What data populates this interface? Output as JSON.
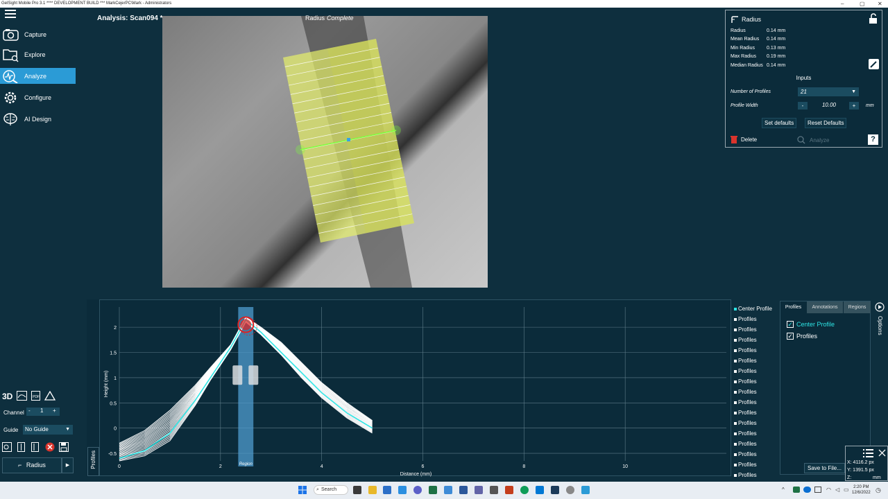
{
  "titlebar": {
    "text": "GelSight Mobile Pro 3.1 **** DEVELOPMENT BUILD ***   MarkCejerPC\\Mark - Administrators"
  },
  "nav": [
    {
      "label": "Capture",
      "icon": "camera-icon"
    },
    {
      "label": "Explore",
      "icon": "folder-search-icon"
    },
    {
      "label": "Analyze",
      "icon": "analyze-icon"
    },
    {
      "label": "Configure",
      "icon": "gear-icon"
    },
    {
      "label": "AI Design",
      "icon": "brain-icon"
    }
  ],
  "analysis": {
    "title": "Analysis: Scan094",
    "title_suffix": "*"
  },
  "image_label": {
    "tool": "Radius",
    "status": "Complete"
  },
  "radius_panel": {
    "title": "Radius",
    "stats": [
      {
        "label": "Radius",
        "value": "0.14 mm"
      },
      {
        "label": "Mean Radius",
        "value": "0.14 mm"
      },
      {
        "label": "Min Radius",
        "value": "0.13 mm"
      },
      {
        "label": "Max Radius",
        "value": "0.19 mm"
      },
      {
        "label": "Median Radius",
        "value": "0.14 mm"
      }
    ],
    "inputs_heading": "Inputs",
    "num_profiles_label": "Number of Profiles",
    "num_profiles_value": "21",
    "profile_width_label": "Profile Width",
    "profile_width_value": "10.00",
    "profile_width_unit": "mm",
    "minus": "-",
    "plus": "+",
    "set_defaults": "Set defaults",
    "reset_defaults": "Reset Defaults",
    "delete": "Delete",
    "analyze": "Analyze",
    "help": "?"
  },
  "chart_data": {
    "type": "line",
    "xlabel": "Distance (mm)",
    "ylabel": "Height (mm)",
    "xlim": [
      0,
      12
    ],
    "ylim": [
      -0.65,
      2.4
    ],
    "x_ticks": [
      "0",
      "2",
      "4",
      "6",
      "8",
      "10"
    ],
    "y_ticks": [
      "2",
      "1.5",
      "1",
      "0.5",
      "0",
      "-0.5"
    ],
    "region_label": "Region",
    "region_x": [
      2.35,
      2.65
    ],
    "series": [
      {
        "name": "Center Profile",
        "x": [
          0,
          0.5,
          1,
          1.5,
          1.8,
          2.2,
          2.5,
          2.8,
          3.2,
          3.6,
          4,
          4.5,
          5
        ],
        "y": [
          -0.6,
          -0.45,
          -0.1,
          0.55,
          1.0,
          1.6,
          2.15,
          1.9,
          1.5,
          1.1,
          0.7,
          0.3,
          0.0
        ]
      },
      {
        "name": "Profiles",
        "x": [
          0,
          0.5,
          1,
          1.5,
          1.8,
          2.2,
          2.5,
          2.8,
          3.2,
          3.6,
          4,
          4.5,
          5
        ],
        "y": [
          -0.3,
          -0.05,
          0.35,
          0.85,
          1.2,
          1.65,
          2.2,
          2.0,
          1.7,
          1.3,
          0.9,
          0.5,
          0.15
        ]
      },
      {
        "name": "Profiles",
        "x": [
          0,
          0.5,
          1,
          1.5,
          1.8,
          2.2,
          2.5,
          2.8,
          3.2,
          3.6,
          4,
          4.5,
          5
        ],
        "y": [
          -0.65,
          -0.55,
          -0.25,
          0.45,
          0.95,
          1.55,
          2.1,
          1.85,
          1.45,
          1.0,
          0.6,
          0.2,
          -0.1
        ]
      }
    ]
  },
  "legend": [
    "Center Profile",
    "Profiles",
    "Profiles",
    "Profiles",
    "Profiles",
    "Profiles",
    "Profiles",
    "Profiles",
    "Profiles",
    "Profiles",
    "Profiles",
    "Profiles",
    "Profiles",
    "Profiles",
    "Profiles",
    "Profiles",
    "Profiles"
  ],
  "tabs": [
    "Profiles",
    "Annotations",
    "Regions"
  ],
  "checks": [
    {
      "label": "Center Profile",
      "checked": true,
      "color": "#2ee6e6"
    },
    {
      "label": "Profiles",
      "checked": true,
      "color": "#ffffff"
    }
  ],
  "options_label": "Options",
  "profiles_side_label": "Profiles",
  "tools": {
    "channel_label": "Channel",
    "channel_value": "1",
    "guide_label": "Guide",
    "guide_value": "No Guide",
    "three_d": "3D",
    "radius_button": "Radius"
  },
  "save_to_file": "Save to File...",
  "coords": {
    "x": "X: 4116.2 px",
    "y": "Y: 1391.5 px",
    "z": "Z:",
    "z_unit": "mm"
  },
  "taskbar": {
    "search": "Search",
    "time": "2:20 PM",
    "date": "12/6/2022"
  },
  "colors": {
    "accent": "#2b9bd6",
    "background": "#0e2f3e",
    "overlay": "#e6f06a",
    "center_profile": "#2ee6e6"
  }
}
